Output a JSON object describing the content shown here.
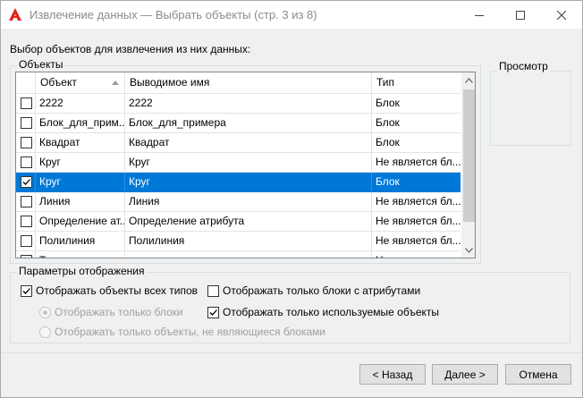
{
  "window": {
    "title": "Извлечение данных — Выбрать объекты (стр. 3 из 8)",
    "icon": "autocad-a-icon",
    "accent_color": "#0078d7",
    "app_icon_color": "#e1251b"
  },
  "prompt": "Выбор объектов для извлечения из них данных:",
  "objects_group": {
    "label": "Объекты",
    "columns": [
      "Объект",
      "Выводимое имя",
      "Тип"
    ],
    "sort_column": "Объект",
    "sort_direction": "ascending",
    "rows": [
      {
        "checked": false,
        "selected": false,
        "object": "2222",
        "display": "2222",
        "type": "Блок"
      },
      {
        "checked": false,
        "selected": false,
        "object": "Блок_для_прим...",
        "display": "Блок_для_примера",
        "type": "Блок"
      },
      {
        "checked": false,
        "selected": false,
        "object": "Квадрат",
        "display": "Квадрат",
        "type": "Блок"
      },
      {
        "checked": false,
        "selected": false,
        "object": "Круг",
        "display": "Круг",
        "type": "Не является бл..."
      },
      {
        "checked": true,
        "selected": true,
        "object": "Круг",
        "display": "Круг",
        "type": "Блок"
      },
      {
        "checked": false,
        "selected": false,
        "object": "Линия",
        "display": "Линия",
        "type": "Не является бл..."
      },
      {
        "checked": false,
        "selected": false,
        "object": "Определение ат...",
        "display": "Определение атрибута",
        "type": "Не является бл..."
      },
      {
        "checked": false,
        "selected": false,
        "object": "Полилиния",
        "display": "Полилиния",
        "type": "Не является бл..."
      },
      {
        "checked": false,
        "selected": false,
        "object": "Т...",
        "display": "",
        "type": "Н..."
      }
    ]
  },
  "preview": {
    "label": "Просмотр"
  },
  "display_options": {
    "label": "Параметры отображения",
    "show_all_types": {
      "label": "Отображать объекты всех типов",
      "checked": true
    },
    "show_blocks_only": {
      "label": "Отображать только блоки",
      "selected": true,
      "enabled": false
    },
    "show_non_blocks": {
      "label": "Отображать только объекты, не являющиеся блоками",
      "selected": false,
      "enabled": false
    },
    "blocks_with_attrs": {
      "label": "Отображать только блоки с атрибутами",
      "checked": false
    },
    "used_objects": {
      "label": "Отображать только используемые объекты",
      "checked": true
    }
  },
  "buttons": {
    "back": "< Назад",
    "next": "Далее >",
    "cancel": "Отмена"
  }
}
